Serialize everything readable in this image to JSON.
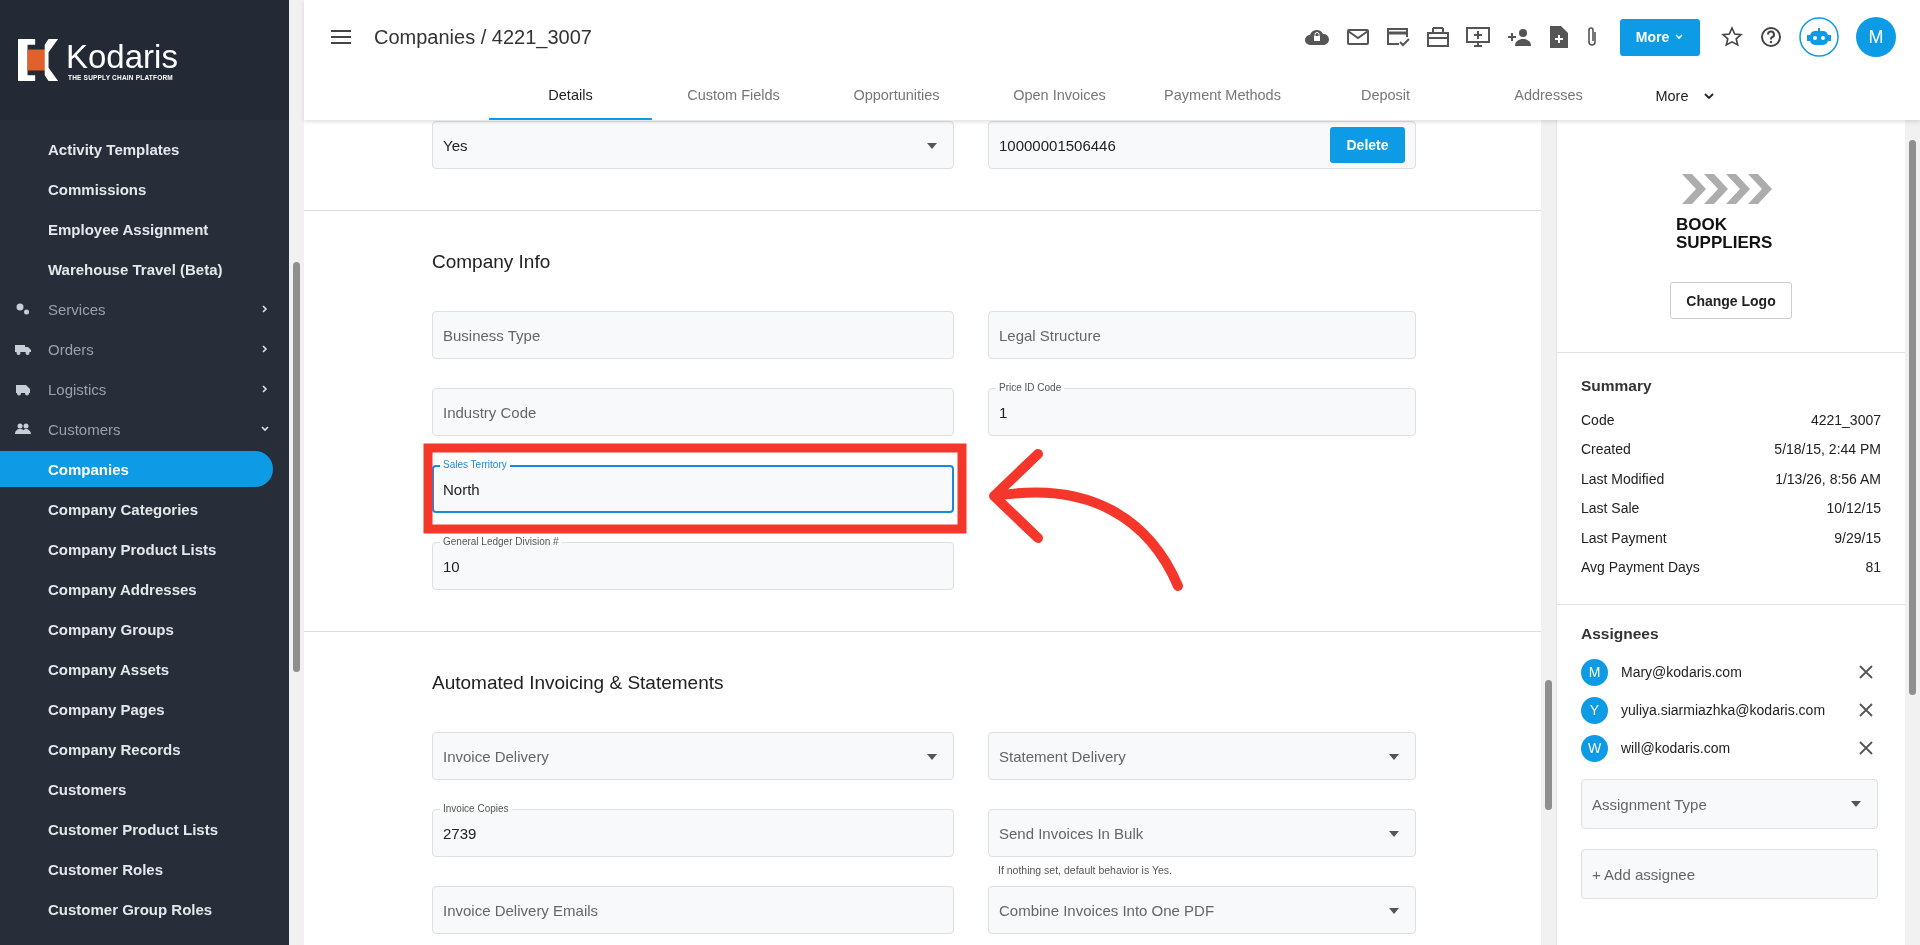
{
  "brand": {
    "name": "Kodaris",
    "tagline": "THE SUPPLY CHAIN PLATFORM"
  },
  "sidebar": {
    "items": [
      {
        "label": "Activity Templates",
        "kind": "link",
        "selected": false
      },
      {
        "label": "Commissions",
        "kind": "link",
        "selected": false
      },
      {
        "label": "Employee Assignment",
        "kind": "link",
        "selected": false
      },
      {
        "label": "Warehouse Travel (Beta)",
        "kind": "link",
        "selected": false
      },
      {
        "label": "Services",
        "kind": "group",
        "selected": false,
        "expanded": false
      },
      {
        "label": "Orders",
        "kind": "group",
        "selected": false,
        "expanded": false
      },
      {
        "label": "Logistics",
        "kind": "group",
        "selected": false,
        "expanded": false
      },
      {
        "label": "Customers",
        "kind": "group",
        "selected": false,
        "expanded": true
      },
      {
        "label": "Companies",
        "kind": "link",
        "selected": true
      },
      {
        "label": "Company Categories",
        "kind": "link",
        "selected": false
      },
      {
        "label": "Company Product Lists",
        "kind": "link",
        "selected": false
      },
      {
        "label": "Company Addresses",
        "kind": "link",
        "selected": false
      },
      {
        "label": "Company Groups",
        "kind": "link",
        "selected": false
      },
      {
        "label": "Company Assets",
        "kind": "link",
        "selected": false
      },
      {
        "label": "Company Pages",
        "kind": "link",
        "selected": false
      },
      {
        "label": "Company Records",
        "kind": "link",
        "selected": false
      },
      {
        "label": "Customers",
        "kind": "link",
        "selected": false
      },
      {
        "label": "Customer Product Lists",
        "kind": "link",
        "selected": false
      },
      {
        "label": "Customer Roles",
        "kind": "link",
        "selected": false
      },
      {
        "label": "Customer Group Roles",
        "kind": "link",
        "selected": false
      }
    ]
  },
  "header": {
    "title": "Companies / 4221_3007",
    "more_button": "More",
    "avatar": "M"
  },
  "tabs": [
    {
      "label": "Details",
      "selected": true
    },
    {
      "label": "Custom Fields",
      "selected": false
    },
    {
      "label": "Opportunities",
      "selected": false
    },
    {
      "label": "Open Invoices",
      "selected": false
    },
    {
      "label": "Payment Methods",
      "selected": false
    },
    {
      "label": "Deposit",
      "selected": false
    },
    {
      "label": "Addresses",
      "selected": false
    }
  ],
  "tabs_more": "More",
  "top_fields": [
    {
      "kind": "select",
      "value": "Yes"
    },
    {
      "kind": "text",
      "value": "10000001506446",
      "button": "Delete"
    }
  ],
  "sections": [
    {
      "title": "Company Info",
      "rows": [
        {
          "left": {
            "label": "Business Type",
            "kind": "text",
            "focused": false
          },
          "right": {
            "label": "Legal Structure",
            "kind": "text",
            "focused": false
          }
        },
        {
          "left": {
            "label": "Industry Code",
            "kind": "text",
            "focused": false
          },
          "right": {
            "label": "Price ID Code",
            "kind": "text",
            "value": "1",
            "focused": false
          }
        },
        {
          "left": {
            "label": "Sales Territory",
            "kind": "text",
            "value": "North",
            "focused": true
          },
          "right": null
        },
        {
          "left": {
            "label": "General Ledger Division #",
            "kind": "text",
            "value": "10",
            "focused": false
          },
          "right": null
        }
      ]
    },
    {
      "title": "Automated Invoicing & Statements",
      "rows": [
        {
          "left": {
            "label": "Invoice Delivery",
            "kind": "select",
            "focused": false
          },
          "right": {
            "label": "Statement Delivery",
            "kind": "select",
            "focused": false
          }
        },
        {
          "left": {
            "label": "Invoice Copies",
            "kind": "text",
            "value": "2739",
            "focused": false
          },
          "right": {
            "label": "Send Invoices In Bulk",
            "kind": "select",
            "focused": false,
            "hint": "If nothing set, default behavior is Yes."
          }
        },
        {
          "left": {
            "label": "Invoice Delivery Emails",
            "kind": "text",
            "focused": false
          },
          "right": {
            "label": "Combine Invoices Into One PDF",
            "kind": "select",
            "focused": false
          }
        }
      ]
    }
  ],
  "company_logo": {
    "lines": [
      "BOOK",
      "SUPPLIERS"
    ]
  },
  "change_logo": "Change Logo",
  "summary": {
    "title": "Summary",
    "rows": [
      {
        "label": "Code",
        "value": "4221_3007"
      },
      {
        "label": "Created",
        "value": "5/18/15, 2:44 PM"
      },
      {
        "label": "Last Modified",
        "value": "1/13/26, 8:56 AM"
      },
      {
        "label": "Last Sale",
        "value": "10/12/15"
      },
      {
        "label": "Last Payment",
        "value": "9/29/15"
      },
      {
        "label": "Avg Payment Days",
        "value": "81"
      }
    ]
  },
  "assignees": {
    "title": "Assignees",
    "people": [
      {
        "initial": "M",
        "email": "Mary@kodaris.com"
      },
      {
        "initial": "Y",
        "email": "yuliya.siarmiazhka@kodaris.com"
      },
      {
        "initial": "W",
        "email": "will@kodaris.com"
      }
    ],
    "assignment_type": "Assignment Type",
    "add_placeholder": "+ Add assignee"
  }
}
